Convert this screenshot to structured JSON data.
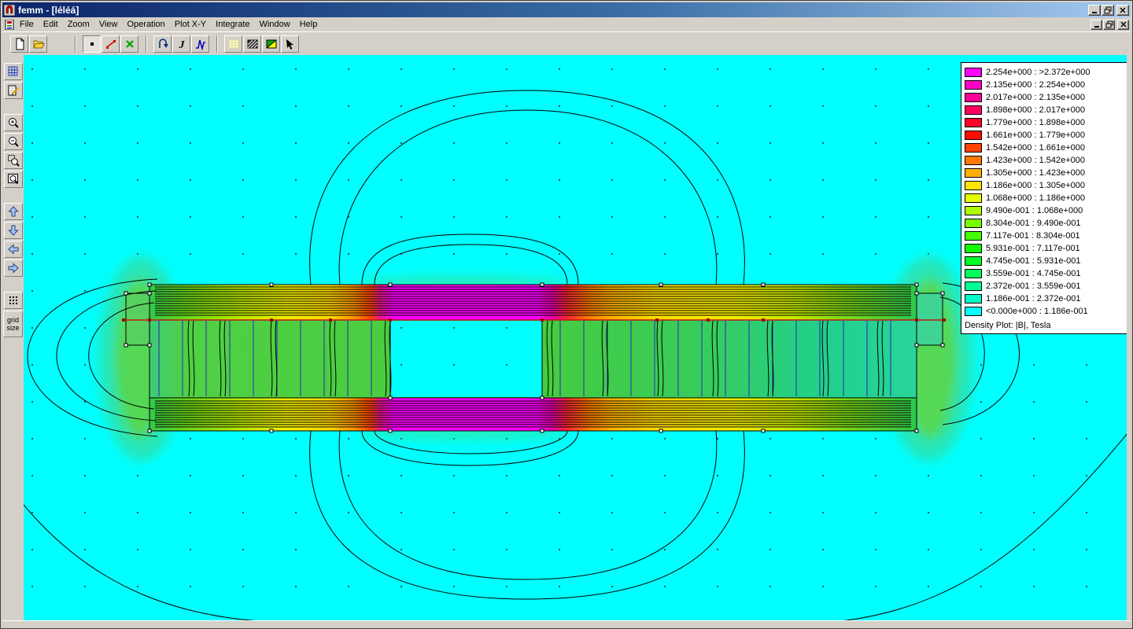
{
  "window": {
    "title": "femm - [léléá]"
  },
  "menu": {
    "items": [
      "File",
      "Edit",
      "Zoom",
      "View",
      "Operation",
      "Plot X-Y",
      "Integrate",
      "Window",
      "Help"
    ]
  },
  "toolbar": {
    "icons": [
      "new-document",
      "open-folder",
      "point-values-mode",
      "contour-mode",
      "block-mode",
      "flip-operation",
      "line-integral",
      "plot-xy",
      "mesh-toggle",
      "density-plot-options",
      "vector-plot-options",
      "pointer"
    ]
  },
  "side_toolbar": {
    "grid_size_label": "grid\nsize",
    "icons": [
      "mesh-window",
      "edit-pad",
      "zoom-in",
      "zoom-out",
      "zoom-window",
      "zoom-extents",
      "pan-up",
      "pan-down",
      "pan-left",
      "pan-right",
      "grid-dots",
      "grid-size"
    ]
  },
  "legend": {
    "title": "Density Plot: |B|, Tesla",
    "entries": [
      {
        "color": "#FF00FF",
        "label": "2.254e+000 : >2.372e+000"
      },
      {
        "color": "#FF00C8",
        "label": "2.135e+000 : 2.254e+000"
      },
      {
        "color": "#FF0094",
        "label": "2.017e+000 : 2.135e+000"
      },
      {
        "color": "#FF005E",
        "label": "1.898e+000 : 2.017e+000"
      },
      {
        "color": "#FF0028",
        "label": "1.779e+000 : 1.898e+000"
      },
      {
        "color": "#FF0D00",
        "label": "1.661e+000 : 1.779e+000"
      },
      {
        "color": "#FF4300",
        "label": "1.542e+000 : 1.661e+000"
      },
      {
        "color": "#FF7900",
        "label": "1.423e+000 : 1.542e+000"
      },
      {
        "color": "#FFAF00",
        "label": "1.305e+000 : 1.423e+000"
      },
      {
        "color": "#FFE400",
        "label": "1.186e+000 : 1.305e+000"
      },
      {
        "color": "#E4FF00",
        "label": "1.068e+000 : 1.186e+000"
      },
      {
        "color": "#AFFF00",
        "label": "9.490e-001 : 1.068e+000"
      },
      {
        "color": "#79FF00",
        "label": "8.304e-001 : 9.490e-001"
      },
      {
        "color": "#43FF00",
        "label": "7.117e-001 : 8.304e-001"
      },
      {
        "color": "#0DFF00",
        "label": "5.931e-001 : 7.117e-001"
      },
      {
        "color": "#00FF28",
        "label": "4.745e-001 : 5.931e-001"
      },
      {
        "color": "#00FF5E",
        "label": "3.559e-001 : 4.745e-001"
      },
      {
        "color": "#00FF94",
        "label": "2.372e-001 : 3.559e-001"
      },
      {
        "color": "#00FFC8",
        "label": "1.186e-001 : 2.372e-001"
      },
      {
        "color": "#00FFFF",
        "label": "<0.000e+000 : 1.186e-001"
      }
    ]
  },
  "colors": {
    "canvas_background": "#00FFFF",
    "flux_line": "#000000",
    "defined_contour": "#C41414",
    "geometry_line": "#2828B8",
    "chrome": "#D4D0C8",
    "titlebar_left": "#0A246A",
    "titlebar_right": "#A6CAF0"
  }
}
